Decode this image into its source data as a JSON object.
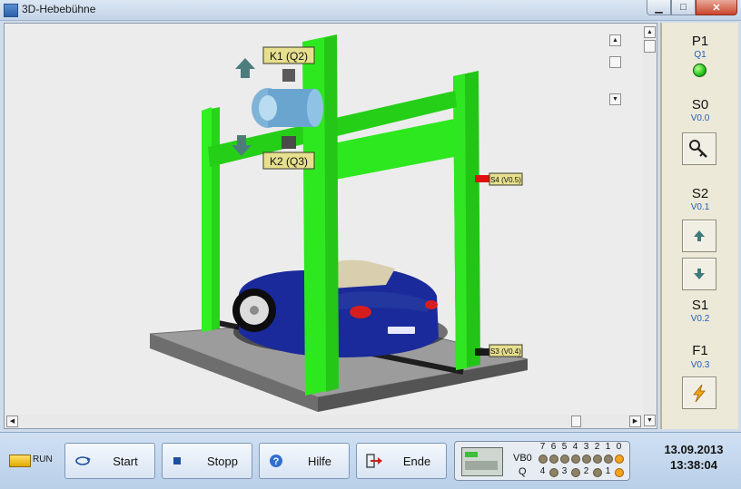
{
  "window": {
    "title": "3D-Hebebühne"
  },
  "scene": {
    "labels": {
      "k1": "K1 (Q2)",
      "k2": "K2 (Q3)",
      "s4": "S4 (V0.5)",
      "s3": "S3 (V0.4)"
    }
  },
  "sidebar": {
    "p1": {
      "label": "P1",
      "sub": "Q1"
    },
    "s0": {
      "label": "S0",
      "sub": "V0.0"
    },
    "s2": {
      "label": "S2",
      "sub": "V0.1"
    },
    "s1": {
      "label": "S1",
      "sub": "V0.2"
    },
    "f1": {
      "label": "F1",
      "sub": "V0.3"
    }
  },
  "taskbar": {
    "run_label": "RUN",
    "buttons": {
      "start": "Start",
      "stopp": "Stopp",
      "hilfe": "Hilfe",
      "ende": "Ende"
    },
    "plc": {
      "vb0_label": "VB0",
      "q_label": "Q",
      "bits_top": [
        "7",
        "6",
        "5",
        "4",
        "3",
        "2",
        "1",
        "0"
      ],
      "bits_q": [
        "4",
        "3",
        "2",
        "1"
      ]
    },
    "date": "13.09.2013",
    "time": "13:38:04"
  },
  "colors": {
    "lift_green": "#2ee81f",
    "car_blue": "#1a2a9a",
    "led_on": "#f7a21c"
  }
}
